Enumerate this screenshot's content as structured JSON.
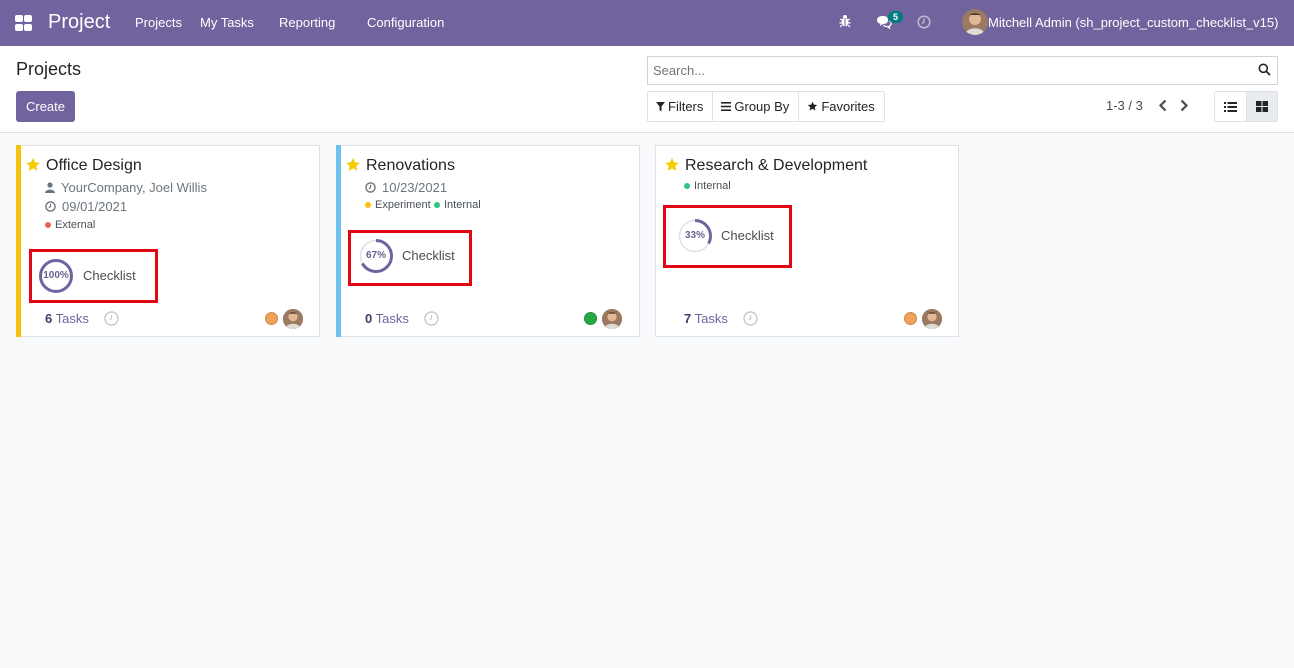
{
  "navbar": {
    "brand": "Project",
    "menu": [
      "Projects",
      "My Tasks",
      "Reporting",
      "Configuration"
    ],
    "messages_count": "5",
    "user_name": "Mitchell Admin (sh_project_custom_checklist_v15)"
  },
  "control_panel": {
    "breadcrumb": "Projects",
    "create_label": "Create",
    "search_placeholder": "Search...",
    "filters_label": "Filters",
    "groupby_label": "Group By",
    "favorites_label": "Favorites",
    "pager": "1-3 / 3"
  },
  "projects": [
    {
      "name": "Office Design",
      "color": "#f4c20d",
      "customer": "YourCompany, Joel Willis",
      "date": "09/01/2021",
      "tags": [
        {
          "label": "External",
          "color": "#f06050"
        }
      ],
      "checklist_percent": "100%",
      "checklist_value": 1.0,
      "checklist_label": "Checklist",
      "task_count": "6",
      "tasks_label": "Tasks",
      "status_color": "#f0a15a"
    },
    {
      "name": "Renovations",
      "color": "#6cc1ed",
      "date": "10/23/2021",
      "tags": [
        {
          "label": "Experiment",
          "color": "#f4c20d"
        },
        {
          "label": "Internal",
          "color": "#30c381"
        }
      ],
      "checklist_percent": "67%",
      "checklist_value": 0.67,
      "checklist_label": "Checklist",
      "task_count": "0",
      "tasks_label": "Tasks",
      "status_color": "#28a745"
    },
    {
      "name": "Research & Development",
      "color": "",
      "tags": [
        {
          "label": "Internal",
          "color": "#30c381"
        }
      ],
      "checklist_percent": "33%",
      "checklist_value": 0.33,
      "checklist_label": "Checklist",
      "task_count": "7",
      "tasks_label": "Tasks",
      "status_color": "#f0a15a"
    }
  ]
}
